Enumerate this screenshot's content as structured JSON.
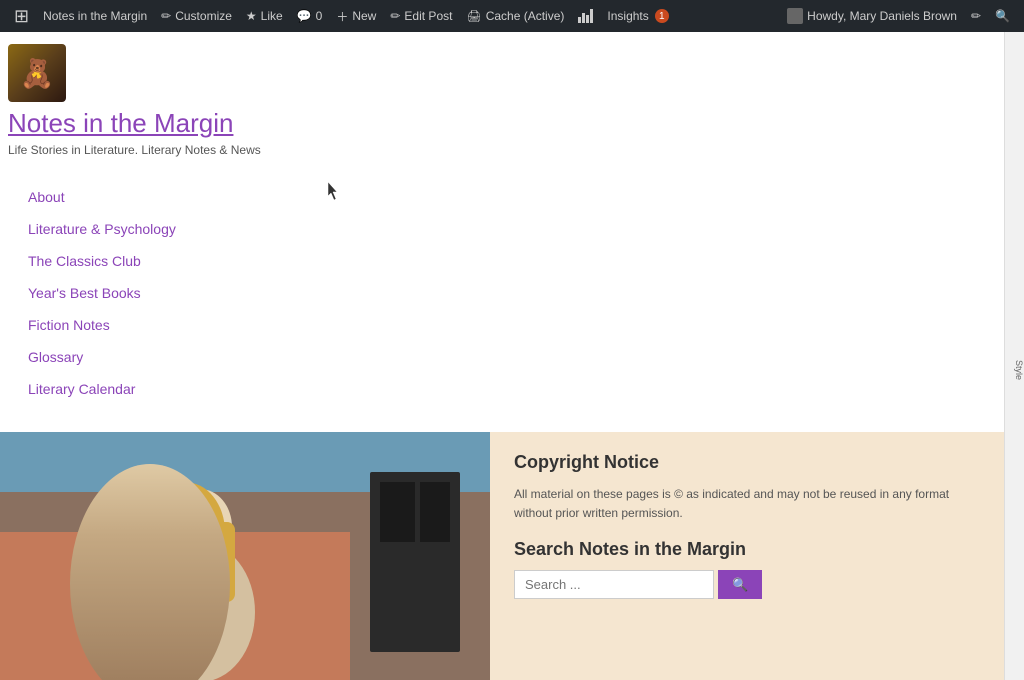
{
  "adminBar": {
    "items": [
      {
        "id": "wp-logo",
        "label": "WordPress",
        "icon": "⊞"
      },
      {
        "id": "site-name",
        "label": "Notes in the Margin"
      },
      {
        "id": "customize",
        "label": "Customize"
      },
      {
        "id": "like",
        "label": "Like"
      },
      {
        "id": "comments",
        "label": "0",
        "prefix": "💬"
      },
      {
        "id": "new",
        "label": "New"
      },
      {
        "id": "edit-post",
        "label": "Edit Post"
      },
      {
        "id": "cache",
        "label": "Cache (Active)"
      },
      {
        "id": "stats",
        "label": ""
      },
      {
        "id": "insights",
        "label": "Insights",
        "badge": "1"
      }
    ],
    "right": {
      "greeting": "Howdy, Mary Daniels Brown"
    }
  },
  "header": {
    "avatarEmoji": "🧸",
    "siteTitle": "Notes in the Margin",
    "tagline": "Life Stories in Literature. Literary Notes & News"
  },
  "nav": {
    "items": [
      {
        "id": "about",
        "label": "About"
      },
      {
        "id": "lit-psych",
        "label": "Literature & Psychology"
      },
      {
        "id": "classics-club",
        "label": "The Classics Club"
      },
      {
        "id": "years-best",
        "label": "Year's Best Books"
      },
      {
        "id": "fiction-notes",
        "label": "Fiction Notes"
      },
      {
        "id": "glossary",
        "label": "Glossary"
      },
      {
        "id": "literary-calendar",
        "label": "Literary Calendar"
      }
    ]
  },
  "footer": {
    "copyright": {
      "title": "Copyright Notice",
      "text": "All material on these pages is © as indicated and may not be reused in any format without prior written permission."
    },
    "search": {
      "title": "Search Notes in the Margin",
      "placeholder": "Search ...",
      "buttonLabel": "🔍"
    }
  },
  "rightPanel": {
    "label": "Style"
  }
}
